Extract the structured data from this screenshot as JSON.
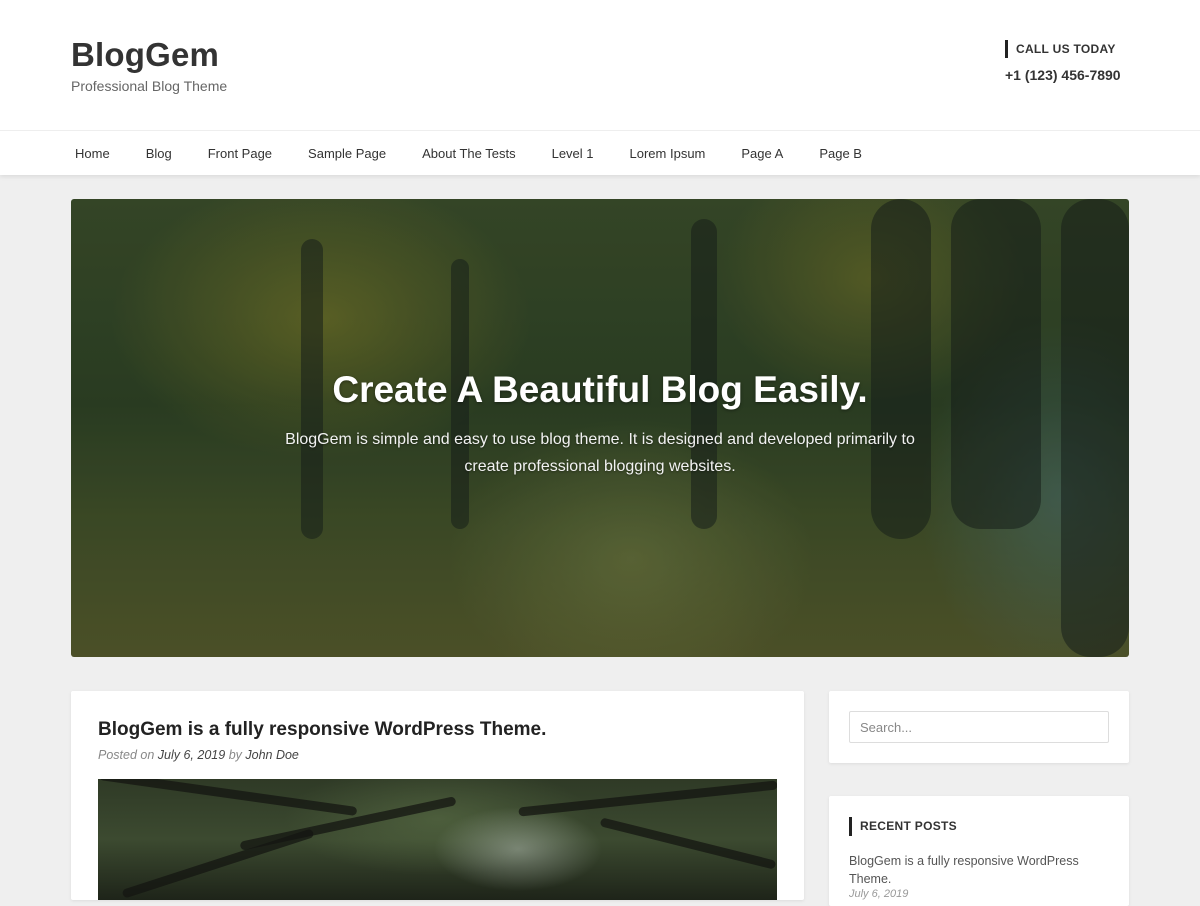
{
  "site": {
    "title": "BlogGem",
    "tagline": "Professional Blog Theme"
  },
  "contact": {
    "label": "CALL US TODAY",
    "phone": "+1 (123) 456-7890"
  },
  "nav": {
    "items": [
      "Home",
      "Blog",
      "Front Page",
      "Sample Page",
      "About The Tests",
      "Level 1",
      "Lorem Ipsum",
      "Page A",
      "Page B"
    ]
  },
  "hero": {
    "title": "Create A Beautiful Blog Easily.",
    "text": "BlogGem is simple and easy to use blog theme. It is designed and developed primarily to create professional blogging websites."
  },
  "post": {
    "title": "BlogGem is a fully responsive WordPress Theme.",
    "posted_on_label": "Posted on",
    "date": "July 6, 2019",
    "by_label": "by",
    "author": "John Doe"
  },
  "sidebar": {
    "search_placeholder": "Search...",
    "recent_posts_title": "RECENT POSTS",
    "recent_posts": [
      {
        "title": "BlogGem is a fully responsive WordPress Theme.",
        "date": "July 6, 2019"
      }
    ]
  },
  "colors": {
    "page_bg": "#efefef",
    "card_bg": "#ffffff",
    "text_dark": "#222222"
  }
}
